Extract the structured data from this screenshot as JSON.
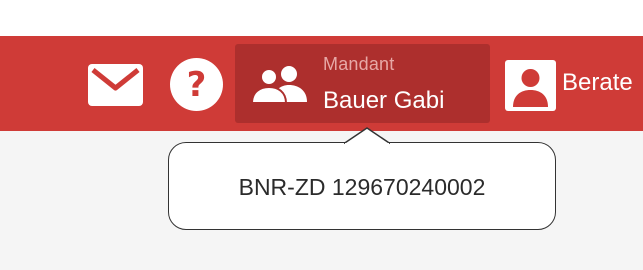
{
  "header": {
    "background_color": "#cf3b37",
    "icons": {
      "mail": "mail-icon",
      "help": "help-icon",
      "people": "people-icon",
      "user": "user-icon"
    },
    "mandant": {
      "label": "Mandant",
      "name": "Bauer Gabi",
      "background_color": "#ad2f2d"
    },
    "berater": {
      "label": "Berate"
    }
  },
  "tooltip": {
    "text": "BNR-ZD 129670240002"
  }
}
